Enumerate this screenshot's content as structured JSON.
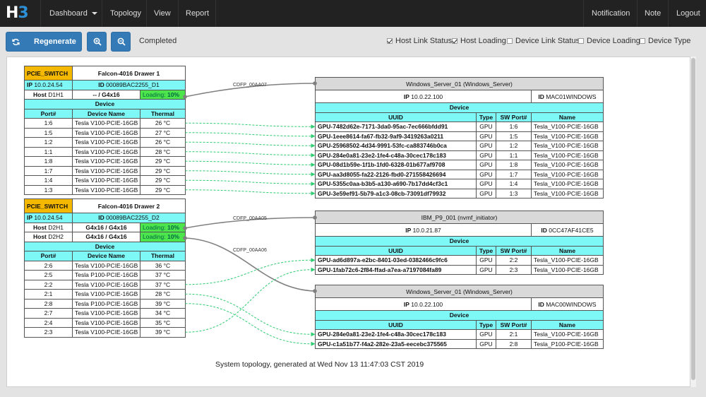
{
  "nav": {
    "logo_h": "H",
    "logo_b": "3",
    "dashboard": "Dashboard",
    "topology": "Topology",
    "view": "View",
    "report": "Report",
    "notification": "Notification",
    "note": "Note",
    "logout": "Logout"
  },
  "toolbar": {
    "regenerate": "Regenerate",
    "status": "Completed",
    "checkboxes": [
      {
        "label": "Host Link Status",
        "checked": true
      },
      {
        "label": "Host Loading",
        "checked": true
      },
      {
        "label": "Device Link Status",
        "checked": false
      },
      {
        "label": "Device Loading",
        "checked": false
      },
      {
        "label": "Device Type",
        "checked": false
      }
    ]
  },
  "switches": [
    {
      "type": "PCIE_SWITCH",
      "name": "Falcon-4016 Drawer 1",
      "ip_label": "IP",
      "ip": "10.0.24.54",
      "id_label": "ID",
      "id": "00089BAC2255_D1",
      "hosts": [
        {
          "label": "Host",
          "name": "D1H1",
          "ports": "-- / G4x16",
          "loading_label": "Loading:",
          "loading": "10%"
        }
      ],
      "device_header": "Device",
      "columns": [
        "Port#",
        "Device Name",
        "Thermal"
      ],
      "devices": [
        {
          "port": "1:6",
          "name": "Tesla V100-PCIE-16GB",
          "thermal": "26 °C"
        },
        {
          "port": "1:5",
          "name": "Tesla V100-PCIE-16GB",
          "thermal": "27 °C"
        },
        {
          "port": "1:2",
          "name": "Tesla V100-PCIE-16GB",
          "thermal": "26 °C"
        },
        {
          "port": "1:1",
          "name": "Tesla V100-PCIE-16GB",
          "thermal": "28 °C"
        },
        {
          "port": "1:8",
          "name": "Tesla V100-PCIE-16GB",
          "thermal": "29 °C"
        },
        {
          "port": "1:7",
          "name": "Tesla V100-PCIE-16GB",
          "thermal": "29 °C"
        },
        {
          "port": "1:4",
          "name": "Tesla V100-PCIE-16GB",
          "thermal": "29 °C"
        },
        {
          "port": "1:3",
          "name": "Tesla V100-PCIE-16GB",
          "thermal": "29 °C"
        }
      ]
    },
    {
      "type": "PCIE_SWITCH",
      "name": "Falcon-4016 Drawer 2",
      "ip_label": "IP",
      "ip": "10.0.24.54",
      "id_label": "ID",
      "id": "00089BAC2255_D2",
      "hosts": [
        {
          "label": "Host",
          "name": "D2H1",
          "ports": "G4x16 / G4x16",
          "loading_label": "Loading:",
          "loading": "10%"
        },
        {
          "label": "Host",
          "name": "D2H2",
          "ports": "G4x16 / G4x16",
          "loading_label": "Loading:",
          "loading": "10%"
        }
      ],
      "device_header": "Device",
      "columns": [
        "Port#",
        "Device Name",
        "Thermal"
      ],
      "devices": [
        {
          "port": "2:6",
          "name": "Tesla V100-PCIE-16GB",
          "thermal": "36 °C"
        },
        {
          "port": "2:5",
          "name": "Tesla P100-PCIE-16GB",
          "thermal": "37 °C"
        },
        {
          "port": "2:2",
          "name": "Tesla V100-PCIE-16GB",
          "thermal": "37 °C"
        },
        {
          "port": "2:1",
          "name": "Tesla V100-PCIE-16GB",
          "thermal": "28 °C"
        },
        {
          "port": "2:8",
          "name": "Tesla P100-PCIE-16GB",
          "thermal": "39 °C"
        },
        {
          "port": "2:7",
          "name": "Tesla V100-PCIE-16GB",
          "thermal": "34 °C"
        },
        {
          "port": "2:4",
          "name": "Tesla V100-PCIE-16GB",
          "thermal": "35 °C"
        },
        {
          "port": "2:3",
          "name": "Tesla V100-PCIE-16GB",
          "thermal": "39 °C"
        }
      ]
    }
  ],
  "servers": [
    {
      "title": "Windows_Server_01 (Windows_Server)",
      "ip_label": "IP",
      "ip": "10.0.22.100",
      "id_label": "ID",
      "id": "MAC01WINDOWS",
      "device_header": "Device",
      "columns": [
        "UUID",
        "Type",
        "SW Port#",
        "Name"
      ],
      "devices": [
        {
          "uuid": "GPU-7482d62e-7171-3da0-95ac-7ec666bfdd91",
          "type": "GPU",
          "port": "1:6",
          "name": "Tesla_V100-PCIE-16GB"
        },
        {
          "uuid": "GPU-1eee8614-fa67-fb32-9af9-3419263a0211",
          "type": "GPU",
          "port": "1:5",
          "name": "Tesla_V100-PCIE-16GB"
        },
        {
          "uuid": "GPU-25968502-4d34-9991-53fc-ca883746b0ca",
          "type": "GPU",
          "port": "1:2",
          "name": "Tesla_V100-PCIE-16GB"
        },
        {
          "uuid": "GPU-284e0a81-23e2-1fe4-c48a-30cec178c183",
          "type": "GPU",
          "port": "1:1",
          "name": "Tesla_V100-PCIE-16GB"
        },
        {
          "uuid": "GPU-08d1b59e-1f1b-1fd0-6328-01b677af9708",
          "type": "GPU",
          "port": "1:8",
          "name": "Tesla_V100-PCIE-16GB"
        },
        {
          "uuid": "GPU-aa3d8055-fa22-2126-fbd0-271558426694",
          "type": "GPU",
          "port": "1:7",
          "name": "Tesla_V100-PCIE-16GB"
        },
        {
          "uuid": "GPU-5355c0aa-b3b5-a130-a690-7b17dd4cf3c1",
          "type": "GPU",
          "port": "1:4",
          "name": "Tesla_V100-PCIE-16GB"
        },
        {
          "uuid": "GPU-3e59ef91-5b79-a1c3-08cb-73091df79932",
          "type": "GPU",
          "port": "1:3",
          "name": "Tesla_V100-PCIE-16GB"
        }
      ]
    },
    {
      "title": "IBM_P9_001 (nvmf_initiator)",
      "ip_label": "IP",
      "ip": "10.0.21.87",
      "id_label": "ID",
      "id": "0CC47AF41CE5",
      "device_header": "Device",
      "columns": [
        "UUID",
        "Type",
        "SW Port#",
        "Name"
      ],
      "devices": [
        {
          "uuid": "GPU-ad6d897a-e2bc-8401-03ed-0382466c9fc6",
          "type": "GPU",
          "port": "2:2",
          "name": "Tesla_V100-PCIE-16GB"
        },
        {
          "uuid": "GPU-1fab72c6-2f84-ffad-a7ea-a7197084fa89",
          "type": "GPU",
          "port": "2:3",
          "name": "Tesla_V100-PCIE-16GB"
        }
      ]
    },
    {
      "title": "Windows_Server_01 (Windows_Server)",
      "ip_label": "IP",
      "ip": "10.0.22.100",
      "id_label": "ID",
      "id": "MAC00WINDOWS",
      "device_header": "Device",
      "columns": [
        "UUID",
        "Type",
        "SW Port#",
        "Name"
      ],
      "devices": [
        {
          "uuid": "GPU-284e0a81-23e2-1fe4-c48a-30cec178c183",
          "type": "GPU",
          "port": "2:1",
          "name": "Tesla_V100-PCIE-16GB"
        },
        {
          "uuid": "GPU-c1a51b77-f4a2-282e-23a5-eecebc375565",
          "type": "GPU",
          "port": "2:8",
          "name": "Tesla_P100-PCIE-16GB"
        }
      ]
    }
  ],
  "links": [
    {
      "label": "CDFP_00AA07"
    },
    {
      "label": "CDFP_00AA05"
    },
    {
      "label": "CDFP_00AA06"
    }
  ],
  "caption": "System topology, generated at Wed Nov 13 11:47:03 CST 2019",
  "colors": {
    "accent": "#337ab7",
    "cyan": "#7ef7f7",
    "yellow": "#f5b800",
    "green": "#4ce64c",
    "link": "#808080",
    "device_link": "#2ecc71"
  }
}
